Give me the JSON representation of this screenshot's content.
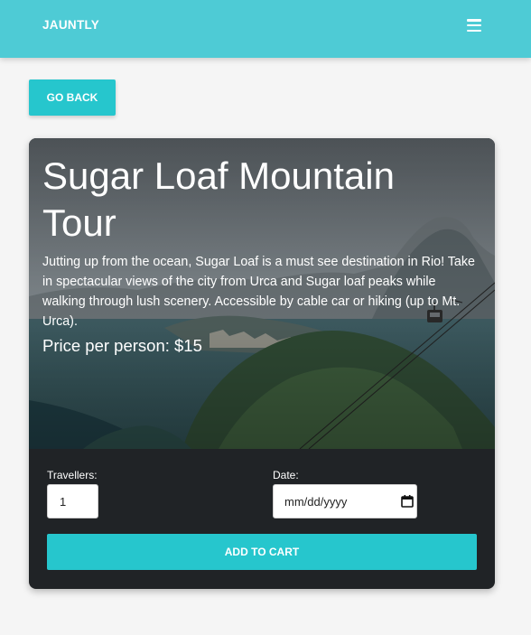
{
  "navbar": {
    "brand": "JAUNTLY",
    "menu_icon": "hamburger-menu-icon",
    "background": "#4ecbd5"
  },
  "go_back_label": "GO BACK",
  "tour": {
    "title": "Sugar Loaf Mountain Tour",
    "description": "Jutting up from the ocean, Sugar Loaf is a must see destination in Rio! Take in spectacular views of the city from Urca and Sugar loaf peaks while walking through lush scenery. Accessible by cable car or hiking (up to Mt. Urca).",
    "price": "Price per person: $15"
  },
  "booking": {
    "travellers_label": "Travellers:",
    "travellers_value": "1",
    "date_label": "Date:",
    "date_placeholder": "mm/dd/yyyy",
    "calendar_icon": "calendar-icon",
    "add_to_cart_label": "ADD TO CART"
  },
  "colors": {
    "accent": "#26c6cd",
    "card_background": "#202326",
    "page_background": "#f5f5f5"
  }
}
